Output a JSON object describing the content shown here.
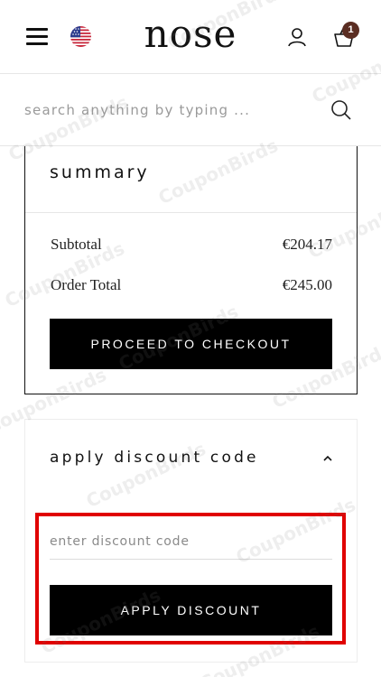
{
  "header": {
    "brand": "nose",
    "cart_count": "1",
    "icons": {
      "menu": "hamburger-menu-icon",
      "flag": "us-flag-icon",
      "user": "user-icon",
      "cart": "shopping-bag-icon"
    },
    "colors": {
      "badge": "#5a2d22"
    }
  },
  "search": {
    "placeholder": "search anything by typing ...",
    "icon": "search-icon"
  },
  "summary": {
    "title": "summary",
    "rows": [
      {
        "label": "Subtotal",
        "value": "€204.17"
      },
      {
        "label": "Order Total",
        "value": "€245.00"
      }
    ],
    "checkout_label": "PROCEED TO CHECKOUT"
  },
  "discount": {
    "title": "apply discount code",
    "input_placeholder": "enter discount code",
    "button_label": "APPLY DISCOUNT",
    "highlight_color": "#e00000"
  },
  "watermark": "CouponBirds"
}
